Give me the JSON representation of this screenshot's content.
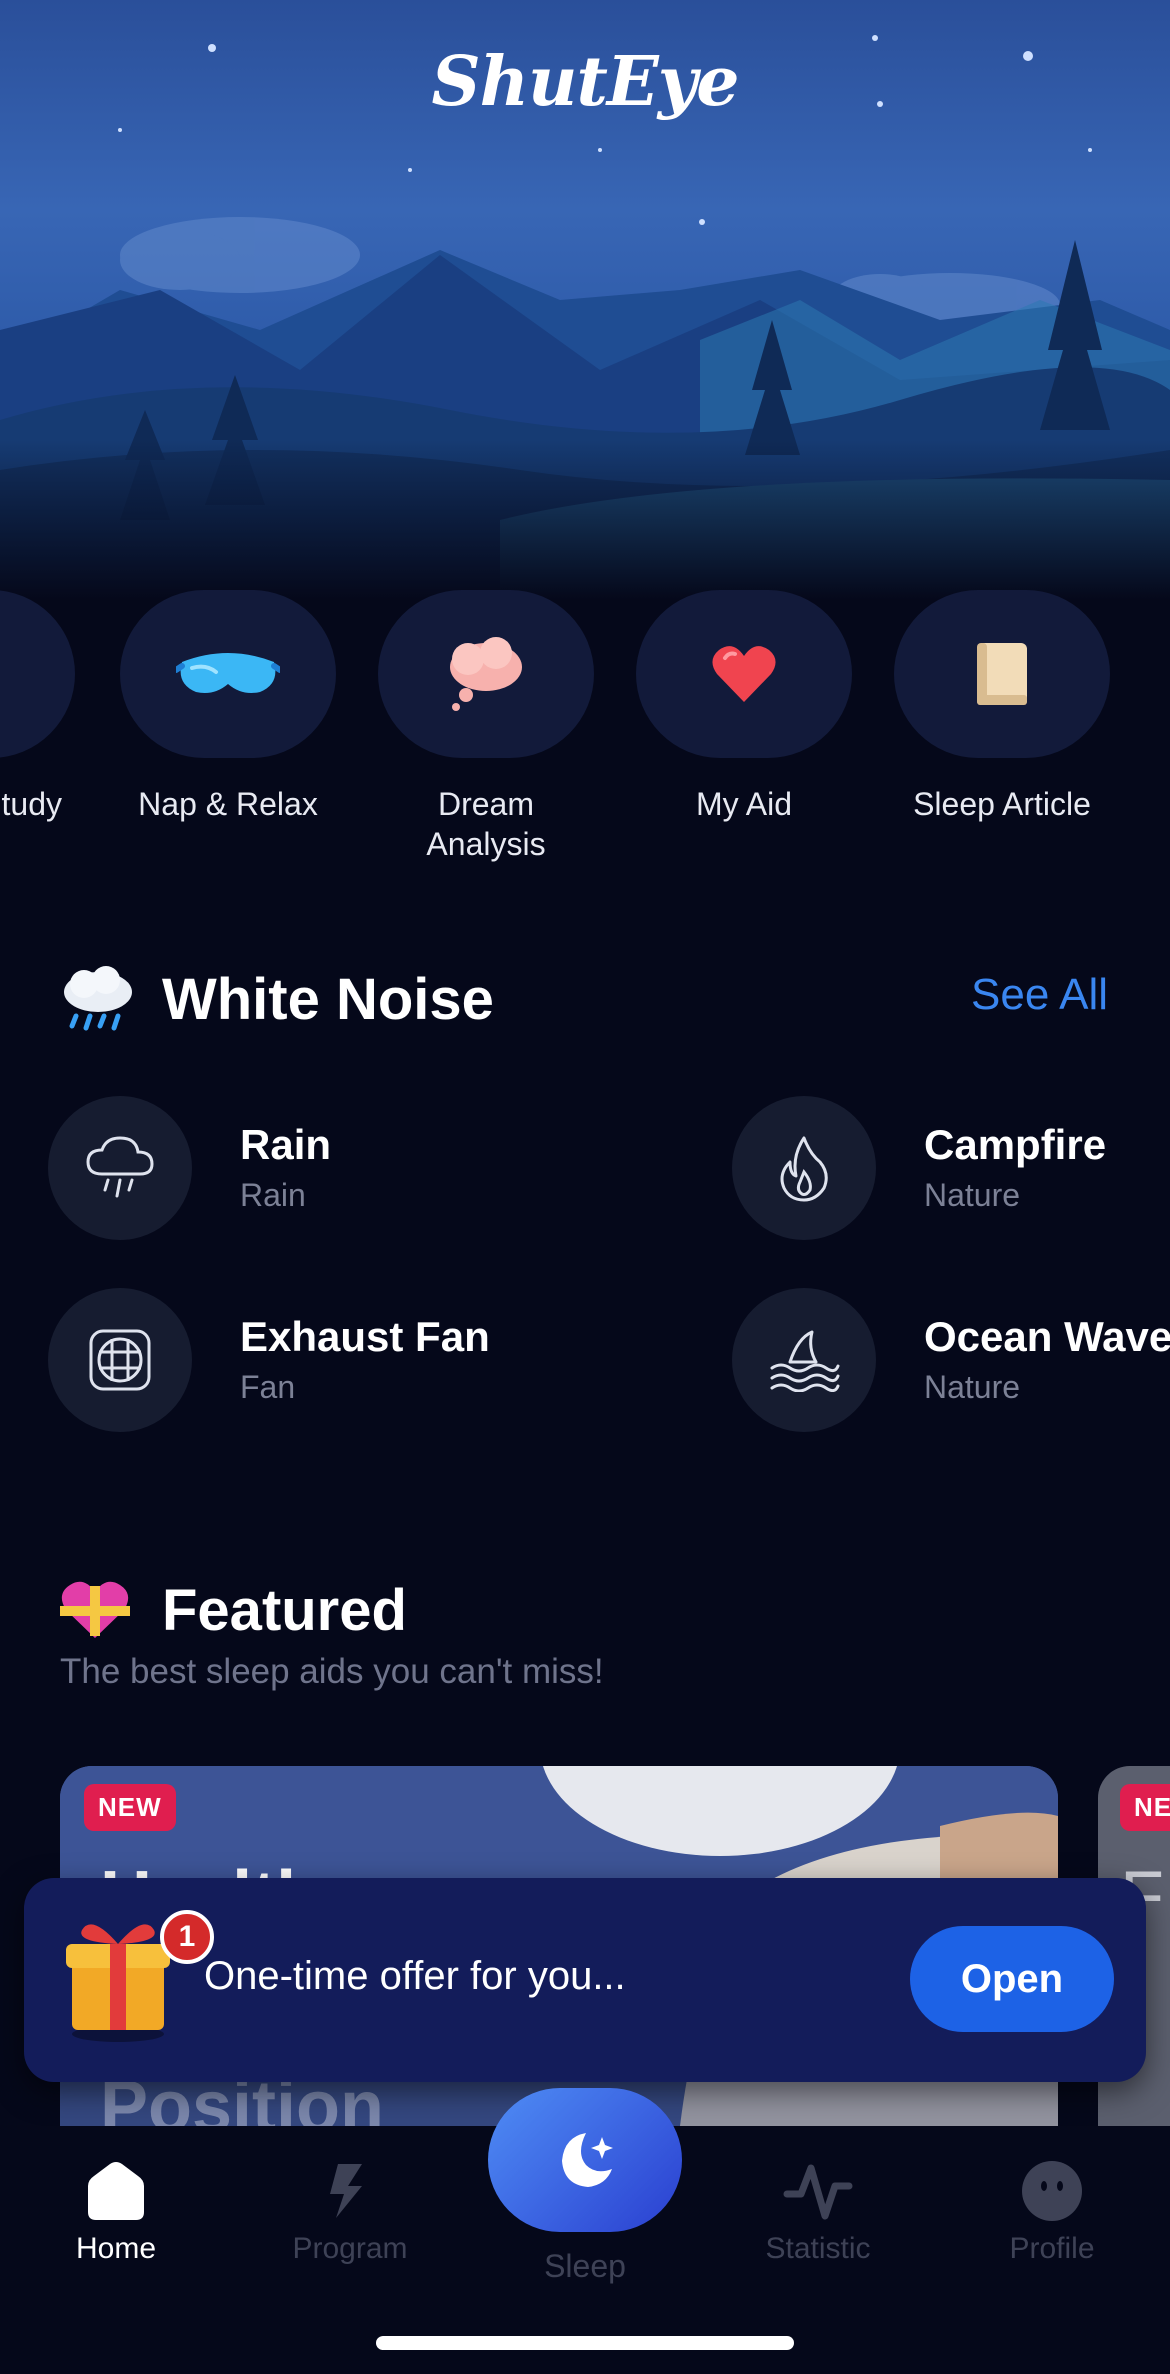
{
  "app": {
    "logo": "ShutEye"
  },
  "categories": [
    {
      "label": "tudy",
      "icon": "book-icon"
    },
    {
      "label": "Nap & Relax",
      "icon": "sleep-mask-icon"
    },
    {
      "label": "Dream\nAnalysis",
      "icon": "thought-cloud-icon"
    },
    {
      "label": "My Aid",
      "icon": "heart-icon"
    },
    {
      "label": "Sleep Article",
      "icon": "notebook-icon"
    }
  ],
  "white_noise": {
    "title": "White Noise",
    "see_all": "See All",
    "items": [
      {
        "name": "Rain",
        "subtitle": "Rain",
        "icon": "rain-cloud-icon"
      },
      {
        "name": "Campfire",
        "subtitle": "Nature",
        "icon": "flame-icon"
      },
      {
        "name": "Exhaust Fan",
        "subtitle": "Fan",
        "icon": "fan-icon"
      },
      {
        "name": "Ocean Wave",
        "subtitle": "Nature",
        "icon": "wave-icon"
      }
    ]
  },
  "featured": {
    "title": "Featured",
    "subtitle": "The best sleep aids you can't miss!",
    "cards": [
      {
        "badge": "NEW",
        "title": "Healthy",
        "title_bottom": "Position"
      },
      {
        "badge": "NE",
        "title": "F"
      }
    ]
  },
  "offer": {
    "text": "One-time offer for you...",
    "button": "Open",
    "count": "1"
  },
  "tabbar": {
    "items": [
      {
        "label": "Home",
        "active": true
      },
      {
        "label": "Program",
        "active": false
      },
      {
        "label": "Sleep",
        "active": false
      },
      {
        "label": "Statistic",
        "active": false
      },
      {
        "label": "Profile",
        "active": false
      }
    ]
  },
  "colors": {
    "background": "#05081a",
    "accent": "#3a86f0",
    "button": "#1d62e6",
    "badge": "#e01e4f",
    "banner": "#131c5a"
  }
}
